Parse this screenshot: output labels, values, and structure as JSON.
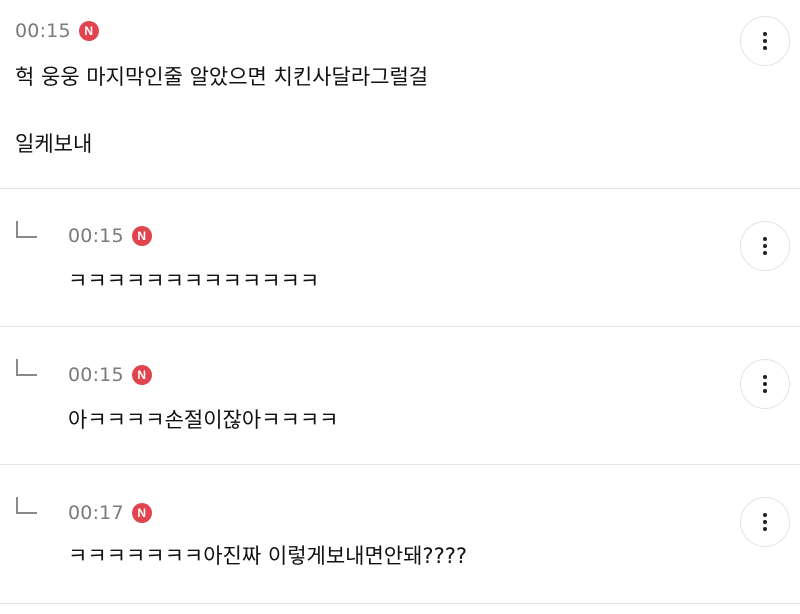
{
  "comments": [
    {
      "time": "00:15",
      "badge": "N",
      "lines": [
        "헉 웅웅 마지막인줄 알았으면 치킨사달라그럴걸",
        "일케보내"
      ],
      "reply": false
    },
    {
      "time": "00:15",
      "badge": "N",
      "lines": [
        "ㅋㅋㅋㅋㅋㅋㅋㅋㅋㅋㅋㅋㅋ"
      ],
      "reply": true
    },
    {
      "time": "00:15",
      "badge": "N",
      "lines": [
        "아ㅋㅋㅋㅋ손절이잖아ㅋㅋㅋㅋ"
      ],
      "reply": true
    },
    {
      "time": "00:17",
      "badge": "N",
      "lines": [
        "ㅋㅋㅋㅋㅋㅋㅋ아진짜 이렇게보내면안돼????"
      ],
      "reply": true
    }
  ],
  "icons": {
    "more": "more-vertical-icon",
    "reply": "reply-arrow-icon",
    "badge": "new-badge-icon"
  },
  "colors": {
    "badge": "#e0444f",
    "time": "#7a7a7a",
    "divider": "#e6e6e6"
  }
}
